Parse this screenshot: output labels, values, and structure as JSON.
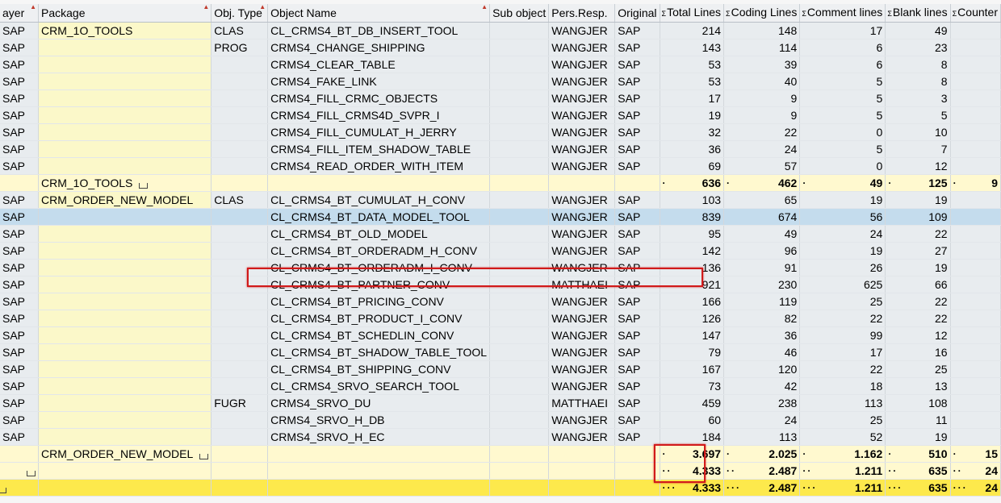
{
  "columns": {
    "layer": "ayer",
    "package": "Package",
    "obj_type": "Obj. Type",
    "object_name": "Object Name",
    "sub_object": "Sub object",
    "pers_resp": "Pers.Resp.",
    "original": "Original",
    "total_lines": "Total Lines",
    "coding_lines": "Coding Lines",
    "comment_lines": "Comment lines",
    "blank_lines": "Blank lines",
    "counter": "Counter"
  },
  "sigma": "Σ",
  "rows": [
    {
      "layer": "SAP",
      "package": "CRM_1O_TOOLS",
      "obj_type": "CLAS",
      "name": "CL_CRMS4_BT_DB_INSERT_TOOL",
      "resp": "WANGJER",
      "orig": "SAP",
      "total": "214",
      "coding": "148",
      "comment": "17",
      "blank": "49"
    },
    {
      "layer": "SAP",
      "package": "",
      "obj_type": "PROG",
      "name": "CRMS4_CHANGE_SHIPPING",
      "resp": "WANGJER",
      "orig": "SAP",
      "total": "143",
      "coding": "114",
      "comment": "6",
      "blank": "23"
    },
    {
      "layer": "SAP",
      "package": "",
      "obj_type": "",
      "name": "CRMS4_CLEAR_TABLE",
      "resp": "WANGJER",
      "orig": "SAP",
      "total": "53",
      "coding": "39",
      "comment": "6",
      "blank": "8"
    },
    {
      "layer": "SAP",
      "package": "",
      "obj_type": "",
      "name": "CRMS4_FAKE_LINK",
      "resp": "WANGJER",
      "orig": "SAP",
      "total": "53",
      "coding": "40",
      "comment": "5",
      "blank": "8"
    },
    {
      "layer": "SAP",
      "package": "",
      "obj_type": "",
      "name": "CRMS4_FILL_CRMC_OBJECTS",
      "resp": "WANGJER",
      "orig": "SAP",
      "total": "17",
      "coding": "9",
      "comment": "5",
      "blank": "3"
    },
    {
      "layer": "SAP",
      "package": "",
      "obj_type": "",
      "name": "CRMS4_FILL_CRMS4D_SVPR_I",
      "resp": "WANGJER",
      "orig": "SAP",
      "total": "19",
      "coding": "9",
      "comment": "5",
      "blank": "5"
    },
    {
      "layer": "SAP",
      "package": "",
      "obj_type": "",
      "name": "CRMS4_FILL_CUMULAT_H_JERRY",
      "resp": "WANGJER",
      "orig": "SAP",
      "total": "32",
      "coding": "22",
      "comment": "0",
      "blank": "10"
    },
    {
      "layer": "SAP",
      "package": "",
      "obj_type": "",
      "name": "CRMS4_FILL_ITEM_SHADOW_TABLE",
      "resp": "WANGJER",
      "orig": "SAP",
      "total": "36",
      "coding": "24",
      "comment": "5",
      "blank": "7"
    },
    {
      "layer": "SAP",
      "package": "",
      "obj_type": "",
      "name": "CRMS4_READ_ORDER_WITH_ITEM",
      "resp": "WANGJER",
      "orig": "SAP",
      "total": "69",
      "coding": "57",
      "comment": "0",
      "blank": "12"
    },
    {
      "subtotal": true,
      "package": "CRM_1O_TOOLS",
      "total": "636",
      "coding": "462",
      "comment": "49",
      "blank": "125",
      "counter": "9"
    },
    {
      "layer": "SAP",
      "package": "CRM_ORDER_NEW_MODEL",
      "obj_type": "CLAS",
      "name": "CL_CRMS4_BT_CUMULAT_H_CONV",
      "resp": "WANGJER",
      "orig": "SAP",
      "total": "103",
      "coding": "65",
      "comment": "19",
      "blank": "19"
    },
    {
      "layer": "SAP",
      "package": "",
      "obj_type": "",
      "name": "CL_CRMS4_BT_DATA_MODEL_TOOL",
      "resp": "WANGJER",
      "orig": "SAP",
      "total": "839",
      "coding": "674",
      "comment": "56",
      "blank": "109",
      "selected": true
    },
    {
      "layer": "SAP",
      "package": "",
      "obj_type": "",
      "name": "CL_CRMS4_BT_OLD_MODEL",
      "resp": "WANGJER",
      "orig": "SAP",
      "total": "95",
      "coding": "49",
      "comment": "24",
      "blank": "22"
    },
    {
      "layer": "SAP",
      "package": "",
      "obj_type": "",
      "name": "CL_CRMS4_BT_ORDERADM_H_CONV",
      "resp": "WANGJER",
      "orig": "SAP",
      "total": "142",
      "coding": "96",
      "comment": "19",
      "blank": "27"
    },
    {
      "layer": "SAP",
      "package": "",
      "obj_type": "",
      "name": "CL_CRMS4_BT_ORDERADM_I_CONV",
      "resp": "WANGJER",
      "orig": "SAP",
      "total": "136",
      "coding": "91",
      "comment": "26",
      "blank": "19"
    },
    {
      "layer": "SAP",
      "package": "",
      "obj_type": "",
      "name": "CL_CRMS4_BT_PARTNER_CONV",
      "resp": "MATTHAEI",
      "orig": "SAP",
      "total": "921",
      "coding": "230",
      "comment": "625",
      "blank": "66"
    },
    {
      "layer": "SAP",
      "package": "",
      "obj_type": "",
      "name": "CL_CRMS4_BT_PRICING_CONV",
      "resp": "WANGJER",
      "orig": "SAP",
      "total": "166",
      "coding": "119",
      "comment": "25",
      "blank": "22"
    },
    {
      "layer": "SAP",
      "package": "",
      "obj_type": "",
      "name": "CL_CRMS4_BT_PRODUCT_I_CONV",
      "resp": "WANGJER",
      "orig": "SAP",
      "total": "126",
      "coding": "82",
      "comment": "22",
      "blank": "22"
    },
    {
      "layer": "SAP",
      "package": "",
      "obj_type": "",
      "name": "CL_CRMS4_BT_SCHEDLIN_CONV",
      "resp": "WANGJER",
      "orig": "SAP",
      "total": "147",
      "coding": "36",
      "comment": "99",
      "blank": "12"
    },
    {
      "layer": "SAP",
      "package": "",
      "obj_type": "",
      "name": "CL_CRMS4_BT_SHADOW_TABLE_TOOL",
      "resp": "WANGJER",
      "orig": "SAP",
      "total": "79",
      "coding": "46",
      "comment": "17",
      "blank": "16"
    },
    {
      "layer": "SAP",
      "package": "",
      "obj_type": "",
      "name": "CL_CRMS4_BT_SHIPPING_CONV",
      "resp": "WANGJER",
      "orig": "SAP",
      "total": "167",
      "coding": "120",
      "comment": "22",
      "blank": "25"
    },
    {
      "layer": "SAP",
      "package": "",
      "obj_type": "",
      "name": "CL_CRMS4_SRVO_SEARCH_TOOL",
      "resp": "WANGJER",
      "orig": "SAP",
      "total": "73",
      "coding": "42",
      "comment": "18",
      "blank": "13"
    },
    {
      "layer": "SAP",
      "package": "",
      "obj_type": "FUGR",
      "name": "CRMS4_SRVO_DU",
      "resp": "MATTHAEI",
      "orig": "SAP",
      "total": "459",
      "coding": "238",
      "comment": "113",
      "blank": "108"
    },
    {
      "layer": "SAP",
      "package": "",
      "obj_type": "",
      "name": "CRMS4_SRVO_H_DB",
      "resp": "WANGJER",
      "orig": "SAP",
      "total": "60",
      "coding": "24",
      "comment": "25",
      "blank": "11"
    },
    {
      "layer": "SAP",
      "package": "",
      "obj_type": "",
      "name": "CRMS4_SRVO_H_EC",
      "resp": "WANGJER",
      "orig": "SAP",
      "total": "184",
      "coding": "113",
      "comment": "52",
      "blank": "19"
    },
    {
      "subtotal": true,
      "package": "CRM_ORDER_NEW_MODEL",
      "total": "3.697",
      "coding": "2.025",
      "comment": "1.162",
      "blank": "510",
      "counter": "15"
    },
    {
      "subtotal": true,
      "level": "layer",
      "package": "",
      "total": "4.333",
      "coding": "2.487",
      "comment": "1.211",
      "blank": "635",
      "counter": "24"
    },
    {
      "grand": true,
      "package": "",
      "total": "4.333",
      "coding": "2.487",
      "comment": "1.211",
      "blank": "635",
      "counter": "24"
    }
  ],
  "colors": {
    "group_cell": "#fbf8c9",
    "subtotal_row": "#fff9cf",
    "grand_total_row": "#fde94c",
    "selected_row": "#c4dced",
    "highlight_box": "#d11a1a"
  }
}
